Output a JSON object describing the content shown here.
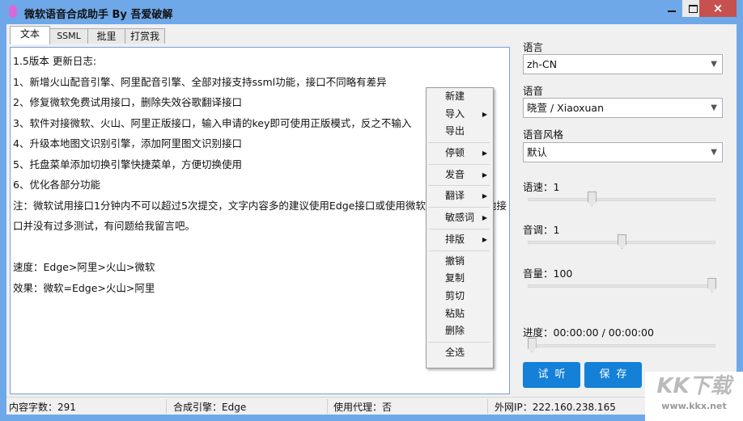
{
  "window": {
    "title": "微软语音合成助手 By 吾爱破解",
    "close": "×"
  },
  "tabs": [
    "文本",
    "SSML",
    "批里",
    "打赏我"
  ],
  "editor": {
    "text": "1.5版本 更新日志:\n1、新增火山配音引擎、阿里配音引擎、全部对接支持ssml功能，接口不同略有差异\n2、修复微软免费试用接口，删除失效谷歌翻译接口\n3、软件对接微软、火山、阿里正版接口，输入申请的key即可使用正版模式，反之不输入\n4、升级本地图文识别引擎，添加阿里图文识别接口\n5、托盘菜单添加切换引擎快捷菜单，方便切换使用\n6、优化各部分功能\n注：微软试用接口1分钟内不可以超过5次提交，文字内容多的建议使用Edge接口或使用微软正版接口，其他接口并没有过多测试，有问题给我留言吧。\n\n速度：Edge>阿里>火山>微软\n效果：微软=Edge>火山>阿里"
  },
  "context_menu": [
    {
      "label": "新建",
      "sub": false
    },
    {
      "label": "导入",
      "sub": true
    },
    {
      "label": "导出",
      "sub": false
    },
    "-",
    {
      "label": "停顿",
      "sub": true
    },
    "-",
    {
      "label": "发音",
      "sub": true
    },
    "-",
    {
      "label": "翻译",
      "sub": true
    },
    "-",
    {
      "label": "敏感词",
      "sub": true
    },
    "-",
    {
      "label": "排版",
      "sub": true
    },
    "-",
    {
      "label": "撤销",
      "sub": false
    },
    {
      "label": "复制",
      "sub": false
    },
    {
      "label": "剪切",
      "sub": false
    },
    {
      "label": "粘贴",
      "sub": false
    },
    {
      "label": "删除",
      "sub": false
    },
    "-",
    {
      "label": "全选",
      "sub": false
    }
  ],
  "settings": {
    "language_label": "语言",
    "language_value": "zh-CN",
    "voice_label": "语音",
    "voice_value": "晓萱 / Xiaoxuan",
    "style_label": "语音风格",
    "style_value": "默认",
    "speed_label": "语速：1",
    "speed_fraction": 0.34,
    "pitch_label": "音调：1",
    "pitch_fraction": 0.5,
    "volume_label": "音量：100",
    "volume_fraction": 0.98,
    "progress_label": "进度：00:00:00 / 00:00:00",
    "progress_fraction": 0.0,
    "preview_button": "试听",
    "save_button": "保存"
  },
  "status": {
    "chars": "内容字数：291",
    "engine": "合成引擎：Edge",
    "proxy": "使用代理：否",
    "ip": "外网IP：222.160.238.165"
  },
  "watermark": {
    "logo": "KK下载",
    "url": "www.kkx.net"
  }
}
